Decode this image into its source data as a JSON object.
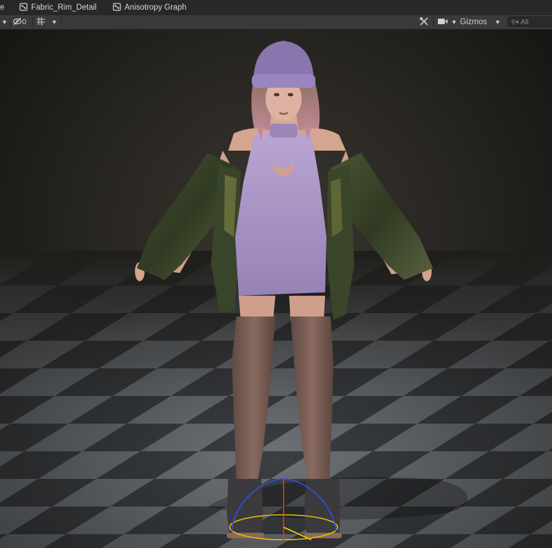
{
  "tabs": [
    {
      "label": "e"
    },
    {
      "label": "Fabric_Rim_Detail"
    },
    {
      "label": "Anisotropy Graph"
    }
  ],
  "toolbar": {
    "hidden_count": "0",
    "gizmos_label": "Gizmos",
    "search_placeholder": "All"
  },
  "icons": {
    "shader_graph": "shader-graph-icon",
    "visibility": "eye-slash-icon",
    "grid": "grid-icon",
    "tools": "tools-icon",
    "camera": "camera-icon",
    "search": "search-icon",
    "dropdown": "chevron-down-icon"
  },
  "colors": {
    "tab_bar": "#282828",
    "toolbar": "#3a3a3a",
    "viewport_bg": "#1f1d1a",
    "floor_light": "#6f7377",
    "floor_dark": "#3c3f42",
    "sweater": "#a58fc0",
    "jacket": "#3e4a2c",
    "gizmo_blue": "#2f4fe0",
    "gizmo_yellow": "#e8c000",
    "gizmo_red": "#e03a2a"
  }
}
